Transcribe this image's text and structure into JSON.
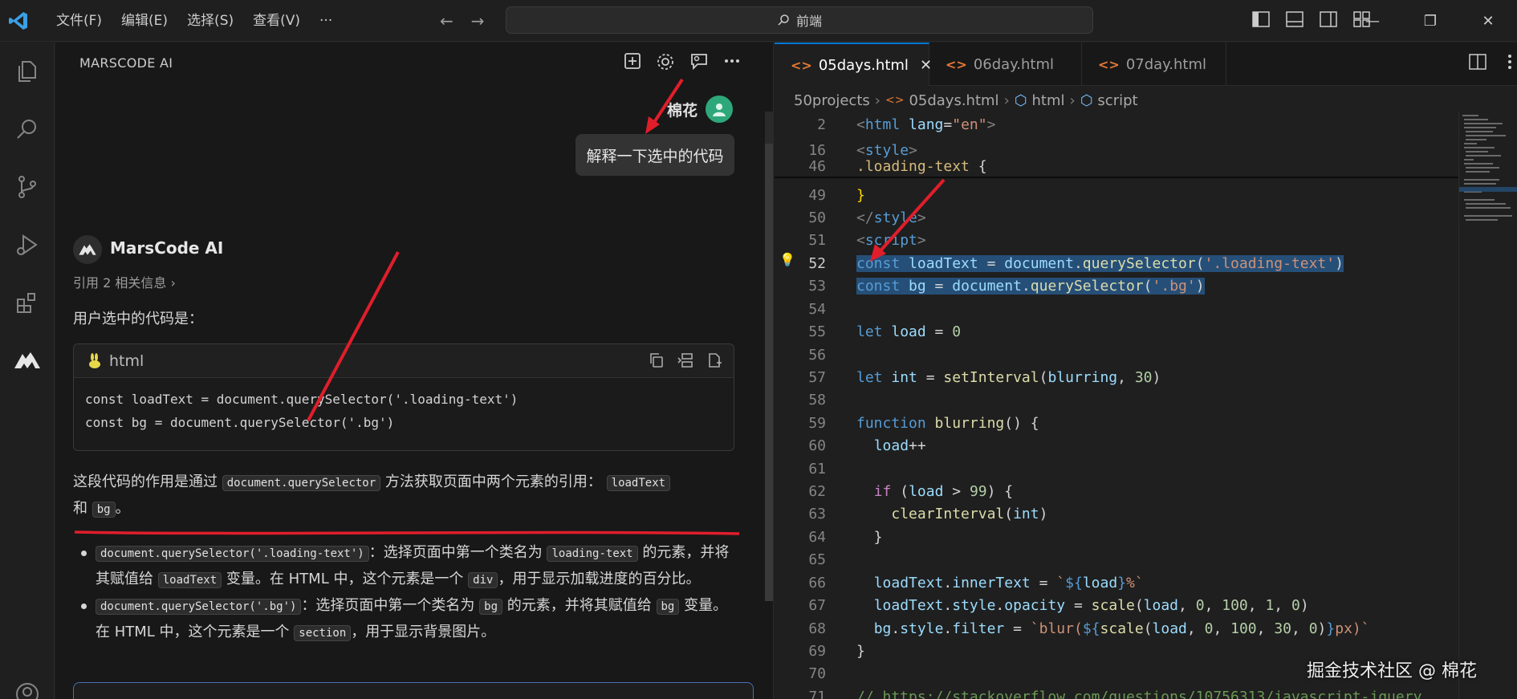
{
  "menu": [
    "文件(F)",
    "编辑(E)",
    "选择(S)",
    "查看(V)",
    "···"
  ],
  "command_center": "前端",
  "side_panel": {
    "title": "MARSCODE AI",
    "user_name": "棉花",
    "user_message": "解释一下选中的代码",
    "ai_name": "MarsCode AI",
    "citation": "引用 2 相关信息 ›",
    "intro": "用户选中的代码是：",
    "code_lang": "html",
    "code_lines": [
      "const loadText = document.querySelector('.loading-text')",
      "const bg = document.querySelector('.bg')"
    ],
    "para_a": "这段代码的作用是通过",
    "para_code1": "document.querySelector",
    "para_b": "方法获取页面中两个元素的引用：",
    "para_code2": "loadText",
    "para_c": "和",
    "para_code3": "bg",
    "para_d": "。",
    "bullet1_code": "document.querySelector('.loading-text')",
    "bullet1_a": "：选择页面中第一个类名为",
    "bullet1_code2": "loading-text",
    "bullet1_b": "的元素，并将其赋值给",
    "bullet1_code3": "loadText",
    "bullet1_c": "变量。在 HTML 中，这个元素是一个",
    "bullet1_code4": "div",
    "bullet1_d": "，用于显示加载进度的百分比。",
    "bullet2_code": "document.querySelector('.bg')",
    "bullet2_a": "：选择页面中第一个类名为",
    "bullet2_code2": "bg",
    "bullet2_b": "的元素，并将其赋值给",
    "bullet2_code3": "bg",
    "bullet2_c": "变量。在 HTML 中，这个元素是一个",
    "bullet2_code4": "section",
    "bullet2_d": "，用于显示背景图片。"
  },
  "editor": {
    "tabs": [
      "05days.html",
      "06day.html",
      "07day.html"
    ],
    "breadcrumb": [
      "50projects",
      "05days.html",
      "html",
      "script"
    ],
    "line_numbers": [
      "2",
      "16",
      "46",
      "49",
      "50",
      "51",
      "52",
      "53",
      "54",
      "55",
      "56",
      "57",
      "58",
      "59",
      "60",
      "61",
      "62",
      "63",
      "64",
      "65",
      "66",
      "67",
      "68",
      "69",
      "70",
      "71"
    ]
  },
  "watermark": "掘金技术社区 @ 棉花"
}
